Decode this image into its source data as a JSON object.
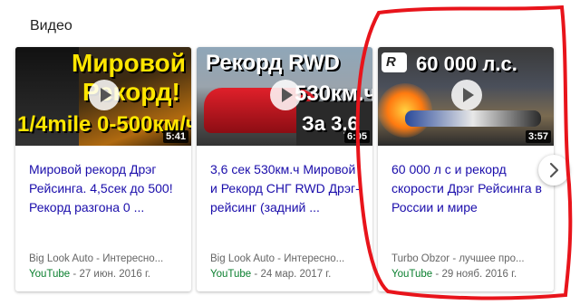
{
  "section": {
    "title": "Видео"
  },
  "videos": [
    {
      "thumb_text": [
        "Мировой",
        "Рекорд!",
        "1/4mile 0-500км/ч"
      ],
      "duration": "5:41",
      "title": "Мировой рекорд Дрэг Рейсинга. 4,5сек до 500! Рекорд разгона 0 ...",
      "channel": "Big Look Auto - Интересно...",
      "source": "YouTube",
      "date": "27 июн. 2016 г."
    },
    {
      "thumb_text": [
        "Рекорд RWD",
        "530км.ч",
        "За 3,6"
      ],
      "duration": "6:05",
      "title": "3,6 сек 530км.ч Мировой и Рекорд СНГ RWD Дрэг-рейсинг (задний ...",
      "channel": "Big Look Auto - Интересно...",
      "source": "YouTube",
      "date": "24 мар. 2017 г."
    },
    {
      "thumb_text": [
        "60 000 л.с."
      ],
      "duration": "3:57",
      "title": "60 000 л с и рекорд скорости Дрэг Рейсинга в России и мире",
      "channel": "Turbo Obzor - лучшее про...",
      "source": "YouTube",
      "date": "29 нояб. 2016 г."
    }
  ],
  "separator": " - ",
  "icons": {
    "next": "chevron-right-icon",
    "play": "play-icon"
  },
  "colors": {
    "link": "#1a0dab",
    "source": "#0a7f2e",
    "highlight": "#e8141b"
  }
}
